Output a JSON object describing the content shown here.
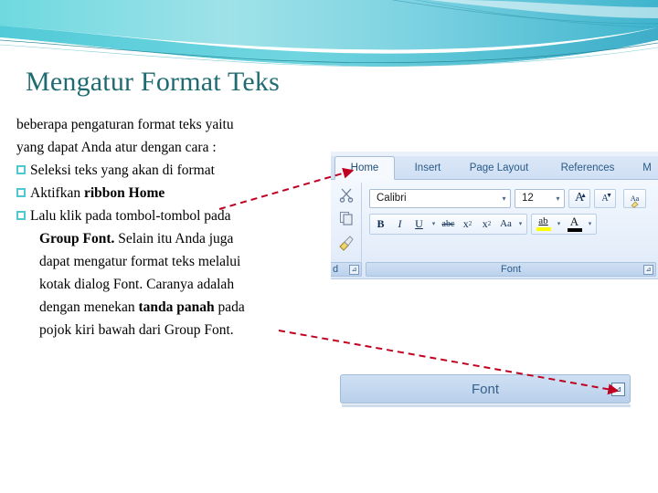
{
  "slide": {
    "title": "Mengatur Format Teks",
    "intro_lines": [
      "beberapa pengaturan format teks yaitu",
      "yang dapat Anda atur dengan cara :"
    ],
    "bullets": [
      {
        "text": "Seleksi teks yang akan di format",
        "bold_part": ""
      },
      {
        "text_before": "Aktifkan ",
        "bold_part": "ribbon Home",
        "text_after": ""
      },
      {
        "text_before": "Lalu klik pada tombol-tombol pada",
        "bold_part": "",
        "text_after": ""
      }
    ],
    "bullet3_cont": [
      {
        "bold": "Group Font.",
        "rest": "   Selain itu Anda juga"
      },
      {
        "bold": "",
        "rest": "dapat mengatur format teks melalui"
      },
      {
        "bold": "",
        "rest": "kotak dialog Font. Caranya adalah"
      },
      {
        "bold_mid_before": "dengan menekan ",
        "bold": "tanda panah",
        "rest": " pada"
      },
      {
        "bold": "",
        "rest": "pojok kiri bawah dari Group Font."
      }
    ],
    "bullet_color": "#4ec9d2",
    "title_color": "#1f6b72",
    "accent_color": "#3ab7c8"
  },
  "ribbon": {
    "tabs": [
      {
        "label": "Home",
        "active": true
      },
      {
        "label": "Insert",
        "active": false
      },
      {
        "label": "Page Layout",
        "active": false
      },
      {
        "label": "References",
        "active": false
      },
      {
        "label": "M",
        "active": false
      }
    ],
    "clipboard": {
      "cut_icon": "scissors-icon",
      "copy_icon": "copy-icon",
      "format_painter_icon": "paintbrush-icon",
      "group_label": "d",
      "launcher_glyph": "⊿"
    },
    "font_group": {
      "font_name_value": "Calibri",
      "font_size_value": "12",
      "grow_font_label": "A",
      "shrink_font_label": "A",
      "clear_formatting_label": "Aa",
      "bold_label": "B",
      "italic_label": "I",
      "underline_label": "U",
      "strikethrough_label": "abc",
      "subscript_label": "x",
      "subscript_sub": "2",
      "superscript_label": "x",
      "superscript_sup": "2",
      "change_case_label": "Aa",
      "highlight_label": "ab",
      "highlight_color": "#ffff00",
      "font_color_label": "A",
      "font_color_value": "#000000",
      "caret": "▾",
      "group_label": "Font",
      "launcher_glyph": "⊿"
    }
  },
  "callout": {
    "label": "Font",
    "launcher_glyph": "⊿"
  }
}
